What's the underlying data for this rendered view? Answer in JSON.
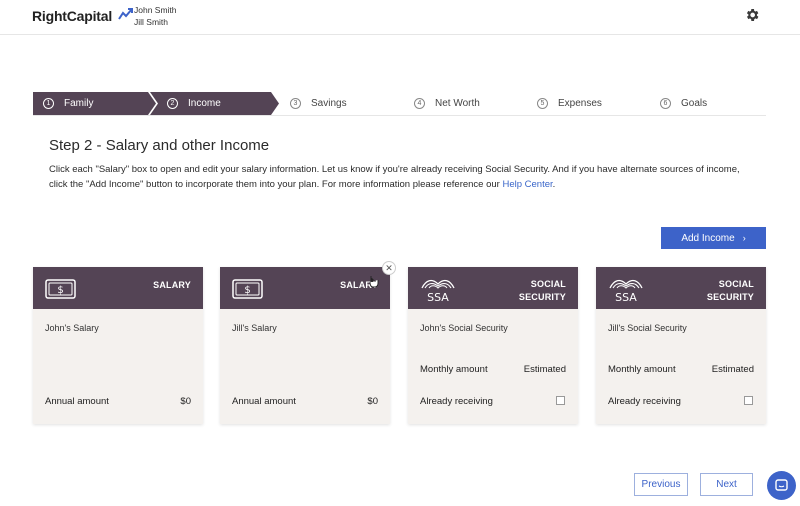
{
  "header": {
    "logo": "RightCapital",
    "clients": [
      "John Smith",
      "Jill Smith"
    ],
    "icons": {
      "settings": "gear-icon"
    }
  },
  "stepper": {
    "steps": [
      {
        "num": "1",
        "label": "Family",
        "state": "completed"
      },
      {
        "num": "2",
        "label": "Income",
        "state": "current"
      },
      {
        "num": "3",
        "label": "Savings",
        "state": "upcoming"
      },
      {
        "num": "4",
        "label": "Net Worth",
        "state": "upcoming"
      },
      {
        "num": "5",
        "label": "Expenses",
        "state": "upcoming"
      },
      {
        "num": "6",
        "label": "Goals",
        "state": "upcoming"
      }
    ]
  },
  "main": {
    "title": "Step 2 - Salary and other Income",
    "description": "Click each \"Salary\" box to open and edit your salary information. Let us know if you're already receiving Social Security. And if you have alternate sources of income, click the \"Add Income\" button to incorporate them into your plan. For more information please reference our ",
    "help_link": "Help Center",
    "description_end": ".",
    "add_income": "Add Income"
  },
  "cards": [
    {
      "type": "SALARY",
      "name": "John's Salary",
      "annual_label": "Annual amount",
      "annual_value": "$0"
    },
    {
      "type": "SALARY",
      "name": "Jill's Salary",
      "annual_label": "Annual amount",
      "annual_value": "$0"
    },
    {
      "type_line1": "SOCIAL",
      "type_line2": "SECURITY",
      "name": "John's Social Security",
      "monthly_label": "Monthly amount",
      "monthly_value": "Estimated",
      "receiving_label": "Already receiving",
      "receiving": false
    },
    {
      "type_line1": "SOCIAL",
      "type_line2": "SECURITY",
      "name": "Jill's Social Security",
      "monthly_label": "Monthly amount",
      "monthly_value": "Estimated",
      "receiving_label": "Already receiving",
      "receiving": false
    }
  ],
  "footer": {
    "previous": "Previous",
    "next": "Next"
  },
  "colors": {
    "brand_purple": "#544455",
    "accent_blue": "#3d63c9",
    "card_bg": "#f4f1ee"
  }
}
